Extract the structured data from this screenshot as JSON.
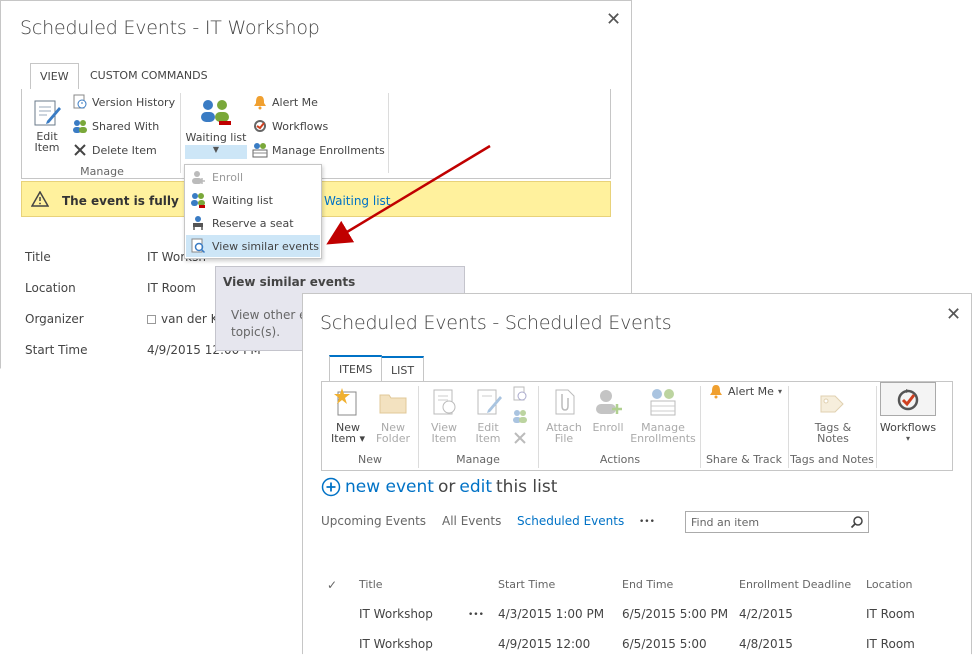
{
  "dialog1": {
    "title": "Scheduled Events - IT Workshop",
    "tabs": [
      "VIEW",
      "CUSTOM COMMANDS"
    ],
    "manage": {
      "edit_item": [
        "Edit",
        "Item"
      ],
      "version_history": "Version History",
      "shared_with": "Shared With",
      "delete_item": "Delete Item",
      "group_label": "Manage"
    },
    "waiting_list_label": "Waiting list",
    "actions": {
      "alert_me": "Alert Me",
      "workflows": "Workflows",
      "manage_enrollments": "Manage Enrollments"
    },
    "dropdown": [
      "Enroll",
      "Waiting list",
      "Reserve a seat",
      "View similar events"
    ],
    "warning": {
      "text": "The event is fully bo",
      "link": "Waiting list"
    },
    "tooltip": {
      "title": "View similar events",
      "body_line1": "View other e",
      "body_line2": "topic(s)."
    },
    "fields": [
      {
        "label": "Title",
        "value": "IT Worksh"
      },
      {
        "label": "Location",
        "value": "IT Room"
      },
      {
        "label": "Organizer",
        "value": "van der K"
      },
      {
        "label": "Start Time",
        "value": "4/9/2015 12:00 PM"
      }
    ]
  },
  "dialog2": {
    "title": "Scheduled Events - Scheduled Events",
    "tabs": [
      "ITEMS",
      "LIST"
    ],
    "new_group": {
      "new_item": [
        "New",
        "Item"
      ],
      "new_folder": [
        "New",
        "Folder"
      ],
      "label": "New"
    },
    "manage_group": {
      "view_item": [
        "View",
        "Item"
      ],
      "edit_item": [
        "Edit",
        "Item"
      ],
      "label": "Manage"
    },
    "actions_group": {
      "attach_file": [
        "Attach",
        "File"
      ],
      "enroll": "Enroll",
      "manage_enrollments": [
        "Manage",
        "Enrollments"
      ],
      "label": "Actions"
    },
    "share_group": {
      "alert_me": "Alert Me",
      "label": "Share & Track"
    },
    "tags_group": {
      "tags_notes": [
        "Tags &",
        "Notes"
      ],
      "label": "Tags and Notes"
    },
    "workflows_label": "Workflows",
    "new_event": {
      "new": "new event",
      "or": "or",
      "edit": "edit",
      "rest": "this list"
    },
    "views": [
      "Upcoming Events",
      "All Events",
      "Scheduled Events",
      "•••"
    ],
    "search_placeholder": "Find an item",
    "columns": [
      "Title",
      "Start Time",
      "End Time",
      "Enrollment Deadline",
      "Location"
    ],
    "rows": [
      [
        "IT Workshop",
        "4/3/2015 1:00 PM",
        "6/5/2015 5:00 PM",
        "4/2/2015",
        "IT Room"
      ],
      [
        "IT Workshop",
        "4/9/2015 12:00",
        "6/5/2015 5:00",
        "4/8/2015",
        "IT Room"
      ]
    ],
    "ellipsis": "•••"
  },
  "colors": {
    "accent": "#0072c6",
    "warning_bg": "#fff19d",
    "highlight": "#cde6f7",
    "arrow": "#c00000"
  }
}
